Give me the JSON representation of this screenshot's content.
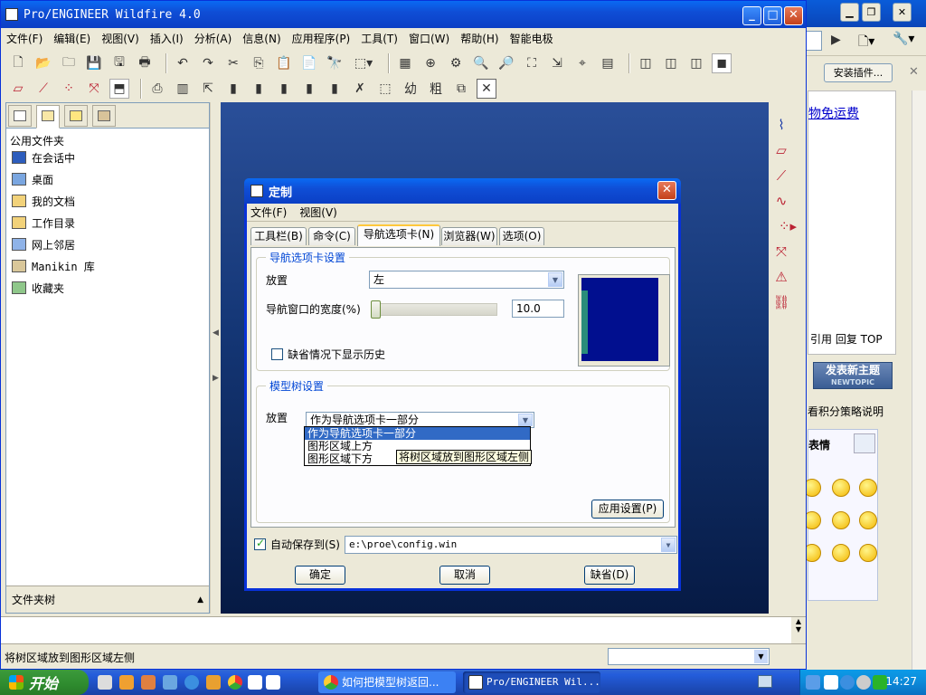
{
  "proe": {
    "title": "Pro/ENGINEER Wildfire 4.0",
    "menu": [
      "文件(F)",
      "编辑(E)",
      "视图(V)",
      "插入(I)",
      "分析(A)",
      "信息(N)",
      "应用程序(P)",
      "工具(T)",
      "窗口(W)",
      "帮助(H)",
      "智能电极"
    ],
    "navigator": {
      "header": "公用文件夹",
      "items": [
        "在会话中",
        "桌面",
        "我的文档",
        "工作目录",
        "网上邻居",
        "Manikin 库",
        "收藏夹"
      ],
      "folder_tree": "文件夹树"
    },
    "status_text": "将树区域放到图形区域左侧"
  },
  "dialog": {
    "title": "定制",
    "menu": [
      "文件(F)",
      "视图(V)"
    ],
    "tabs": [
      "工具栏(B)",
      "命令(C)",
      "导航选项卡(N)",
      "浏览器(W)",
      "选项(O)"
    ],
    "active_tab": "导航选项卡(N)",
    "nav_group": {
      "legend": "导航选项卡设置",
      "placement_label": "放置",
      "placement_value": "左",
      "width_label": "导航窗口的宽度(%)",
      "width_value": "10.0",
      "history_label": "缺省情况下显示历史",
      "history_checked": false
    },
    "tree_group": {
      "legend": "模型树设置",
      "placement_label": "放置",
      "placement_value": "作为导航选项卡一部分",
      "options": [
        "作为导航选项卡一部分",
        "图形区域上方",
        "图形区域下方"
      ],
      "selected_option_index": 0,
      "tooltip": "将树区域放到图形区域左侧",
      "apply_button": "应用设置(P)"
    },
    "autosave_label": "自动保存到(S)",
    "autosave_checked": true,
    "autosave_path": "e:\\proe\\config.win",
    "ok_button": "确定",
    "cancel_button": "取消",
    "default_button": "缺省(D)"
  },
  "browser": {
    "install_plugin": "安装插件...",
    "link_text": "物免运费",
    "ref_text": "引用 回复 TOP",
    "post_button": "发表新主题",
    "post_button_sub": "NEWTOPIC",
    "note": "看积分策略说明",
    "emoticon_tab": "表情"
  },
  "taskbar": {
    "start": "开始",
    "tasks": [
      "如何把模型树返回...",
      "Pro/ENGINEER Wil..."
    ],
    "clock": "14:27"
  }
}
